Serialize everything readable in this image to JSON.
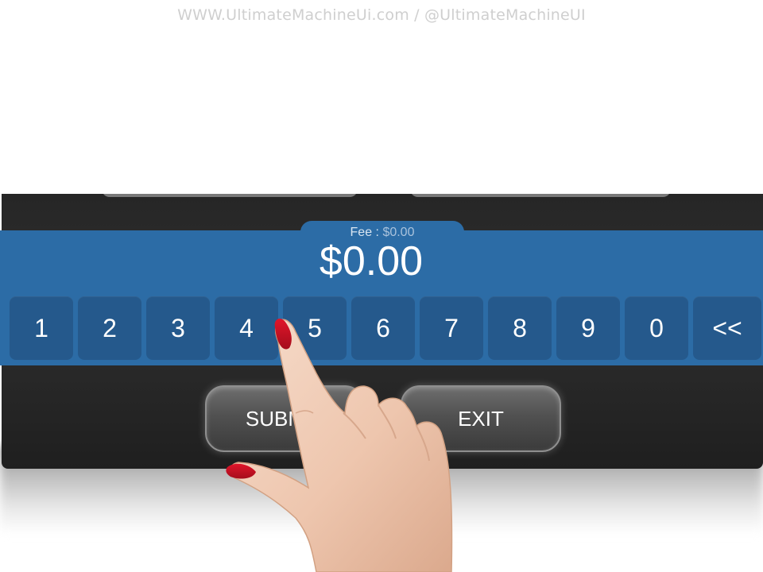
{
  "watermark": "WWW.UltimateMachineUi.com / @UltimateMachineUI",
  "fee": {
    "label": "Fee :",
    "value": "$0.00"
  },
  "amount": "$0.00",
  "keypad": [
    "1",
    "2",
    "3",
    "4",
    "5",
    "6",
    "7",
    "8",
    "9",
    "0",
    "<<"
  ],
  "buttons": {
    "submit": "SUBMIT",
    "exit": "EXIT"
  },
  "colors": {
    "accent": "#2c6ca6",
    "key": "#25598c",
    "panel": "#262626"
  }
}
